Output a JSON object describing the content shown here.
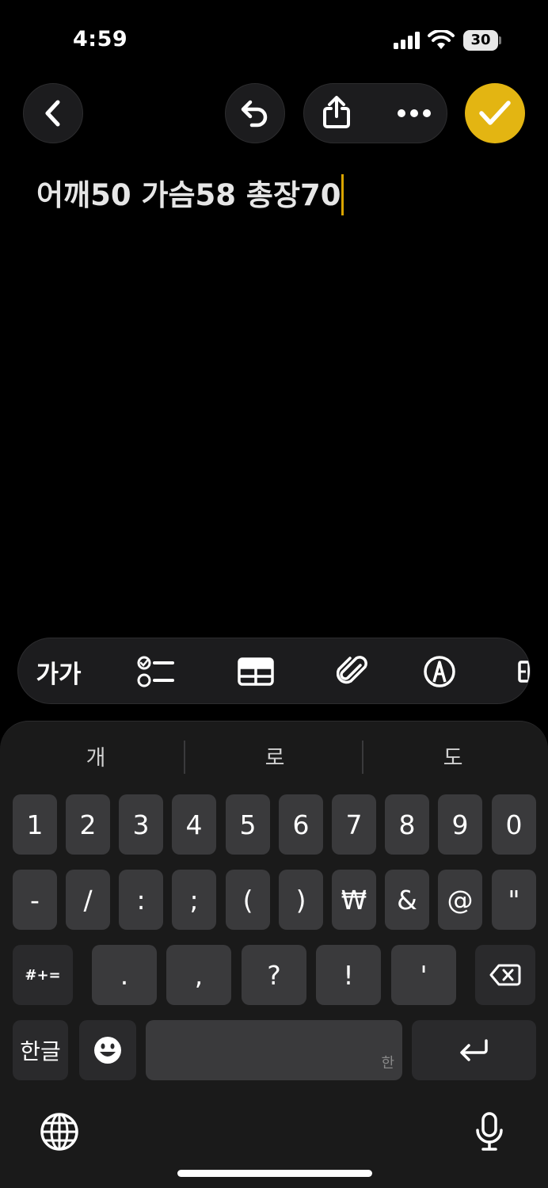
{
  "status_bar": {
    "time": "4:59",
    "battery": "30"
  },
  "nav": {
    "back_icon": "chevron-left-icon",
    "undo_icon": "undo-icon",
    "share_icon": "share-icon",
    "more_icon": "ellipsis-icon",
    "done_icon": "checkmark-icon",
    "done_color": "#e3b512"
  },
  "note": {
    "text": "어깨50 가슴58 총장70",
    "caret_color": "#d9a400"
  },
  "toolbar": {
    "text_format": "가가",
    "checklist_icon": "checklist-icon",
    "table_icon": "table-icon",
    "attachment_icon": "paperclip-icon",
    "markup_icon": "pen-circle-icon"
  },
  "keyboard": {
    "suggestions": [
      "개",
      "로",
      "도"
    ],
    "row_numbers": [
      "1",
      "2",
      "3",
      "4",
      "5",
      "6",
      "7",
      "8",
      "9",
      "0"
    ],
    "row_symbols": [
      "-",
      "/",
      ":",
      ";",
      "(",
      ")",
      "₩",
      "&",
      "@",
      "\""
    ],
    "row_punct": [
      ".",
      ",",
      "?",
      "!",
      "'"
    ],
    "shift_symbols": "#+=",
    "lang_switch": "한글",
    "space_hint": "한",
    "delete_icon": "delete-icon",
    "return_icon": "return-icon",
    "emoji_icon": "emoji-icon",
    "globe_icon": "globe-icon",
    "mic_icon": "mic-icon"
  }
}
